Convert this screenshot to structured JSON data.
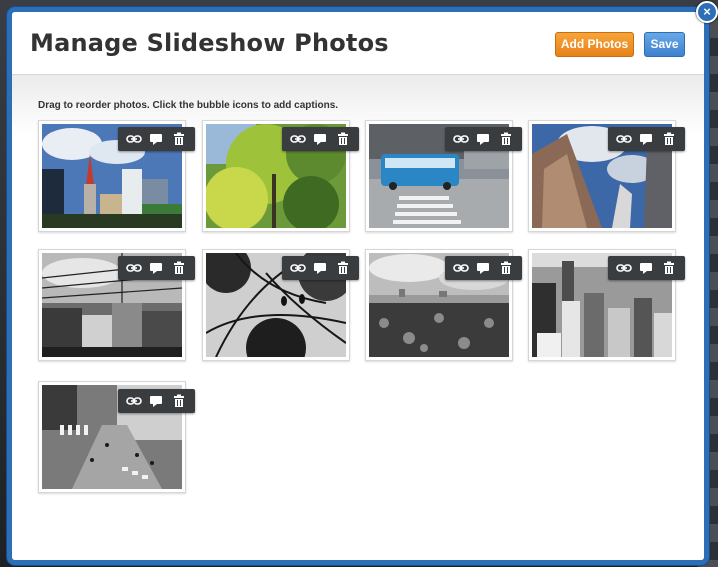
{
  "modal": {
    "title": "Manage Slideshow Photos",
    "add_photos_label": "Add Photos",
    "save_label": "Save",
    "close_label": "×",
    "instructions": "Drag to reorder photos. Click the bubble icons to add captions."
  },
  "photo_tools": [
    "link-icon",
    "caption-bubble-icon",
    "trash-icon"
  ],
  "photos": [
    {
      "name": "photo-1",
      "scene": "city towers under cloudy blue sky"
    },
    {
      "name": "photo-2",
      "scene": "green tree canopy"
    },
    {
      "name": "photo-3",
      "scene": "bus at crosswalk"
    },
    {
      "name": "photo-4",
      "scene": "building looking up"
    },
    {
      "name": "photo-5",
      "scene": "bw power lines"
    },
    {
      "name": "photo-6",
      "scene": "bw tree branches with birds"
    },
    {
      "name": "photo-7",
      "scene": "bw pond skyline"
    },
    {
      "name": "photo-8",
      "scene": "bw aerial city"
    },
    {
      "name": "photo-9",
      "scene": "bw street crossing from above"
    }
  ],
  "colors": {
    "modal_border": "#2c6fb6",
    "add_button": "#e7821a",
    "save_button": "#3d82cf",
    "toolbar": "#3a3d40"
  }
}
